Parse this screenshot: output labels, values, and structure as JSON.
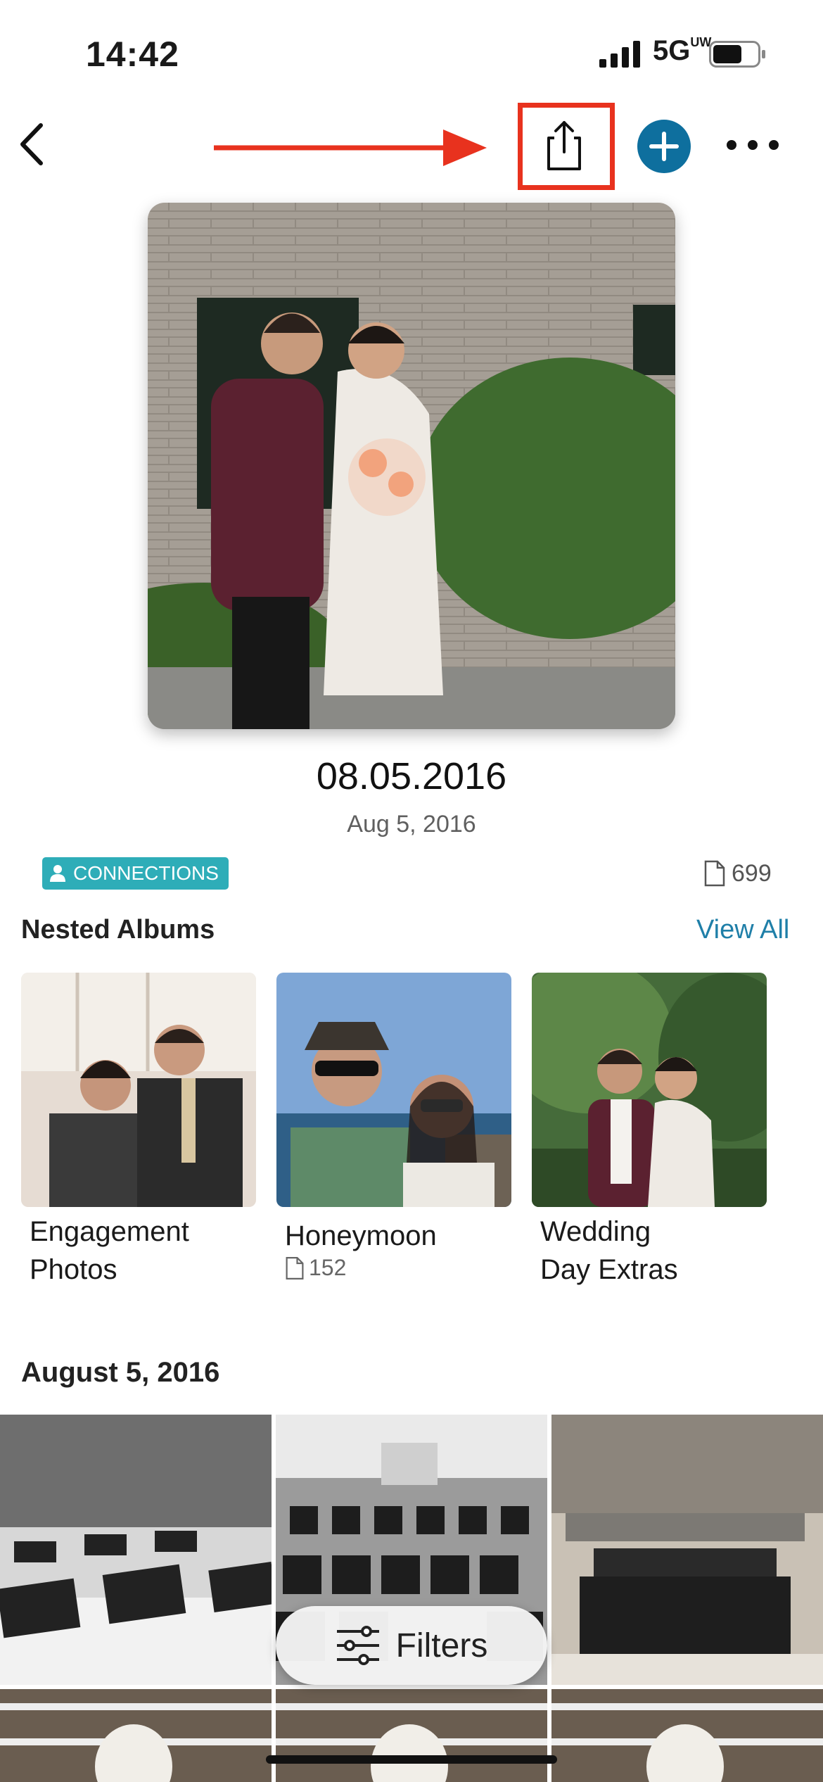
{
  "status_bar": {
    "time": "14:42",
    "network": "5G",
    "network_superscript": "UW"
  },
  "header": {
    "back_icon": "chevron-left-icon",
    "share_icon": "share-icon",
    "add_icon": "plus-icon",
    "more_icon": "ellipsis-icon"
  },
  "annotation": {
    "arrow_color": "#e8321e",
    "highlight_color": "#e8321e"
  },
  "album": {
    "title": "08.05.2016",
    "date": "Aug 5, 2016",
    "badge": "CONNECTIONS",
    "item_count": "699"
  },
  "nested": {
    "heading": "Nested Albums",
    "view_all": "View All",
    "items": [
      {
        "label_line1": "Engagement",
        "label_line2": "Photos",
        "count": ""
      },
      {
        "label_line1": "Honeymoon",
        "label_line2": "",
        "count": "152"
      },
      {
        "label_line1": "Wedding",
        "label_line2": "Day Extras",
        "count": ""
      }
    ]
  },
  "section": {
    "date_heading": "August 5, 2016"
  },
  "filters": {
    "label": "Filters"
  },
  "colors": {
    "accent": "#0e6f9e",
    "badge": "#2eadb8",
    "link": "#1f7fa8"
  }
}
